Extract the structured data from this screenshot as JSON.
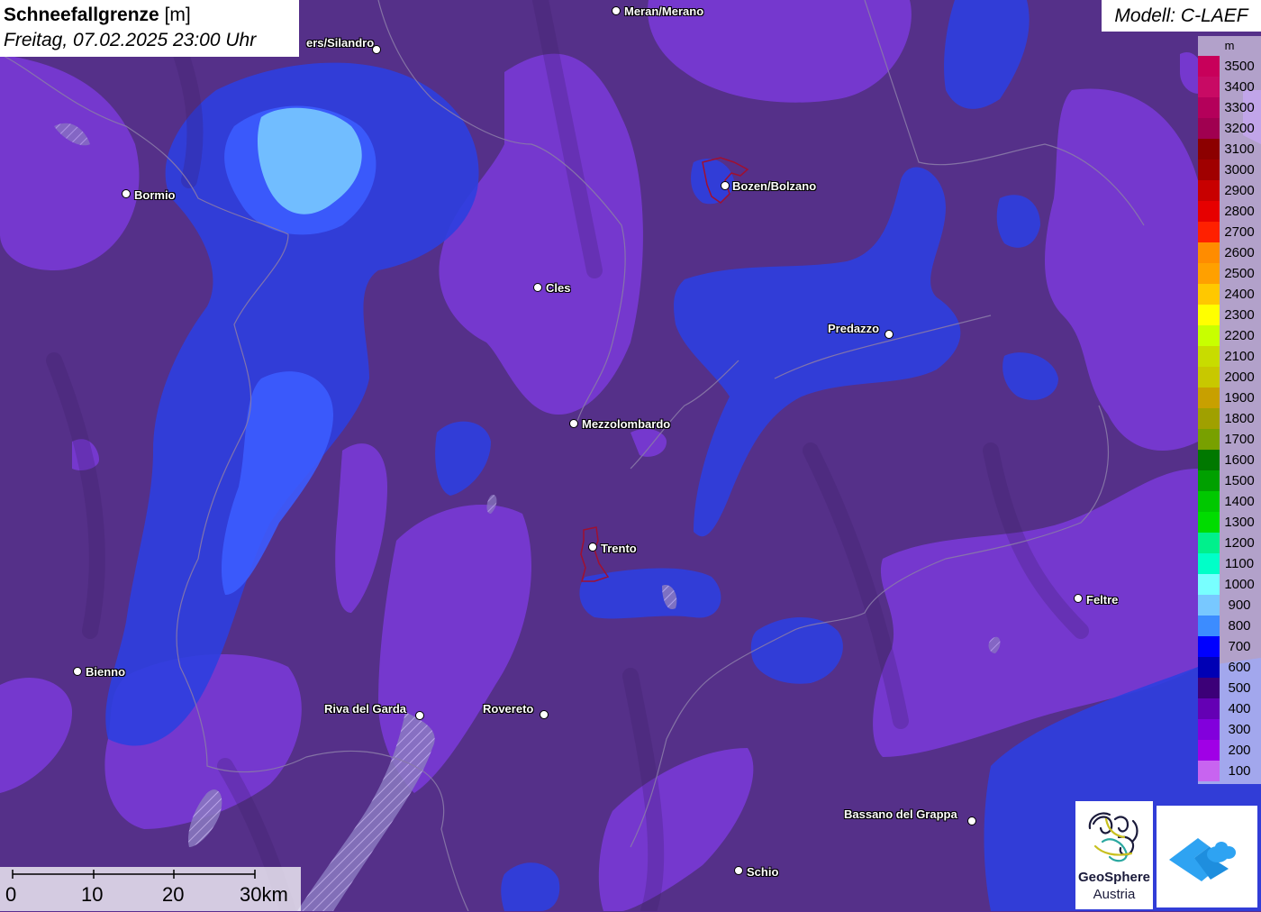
{
  "title": {
    "parameter": "Schneefallgrenze",
    "unit": "[m]",
    "datetime": "Freitag, 07.02.2025 23:00 Uhr"
  },
  "model_label": "Modell: C-LAEF",
  "legend": {
    "unit": "m",
    "entries": [
      {
        "label": "3500",
        "color": "#c8005a"
      },
      {
        "label": "3400",
        "color": "#c80a64"
      },
      {
        "label": "3300",
        "color": "#b4005a"
      },
      {
        "label": "3200",
        "color": "#a00050"
      },
      {
        "label": "3100",
        "color": "#8c0000"
      },
      {
        "label": "3000",
        "color": "#a00000"
      },
      {
        "label": "2900",
        "color": "#c80000"
      },
      {
        "label": "2800",
        "color": "#e60000"
      },
      {
        "label": "2700",
        "color": "#ff2000"
      },
      {
        "label": "2600",
        "color": "#ff8c00"
      },
      {
        "label": "2500",
        "color": "#ffa000"
      },
      {
        "label": "2400",
        "color": "#ffc800"
      },
      {
        "label": "2300",
        "color": "#ffff00"
      },
      {
        "label": "2200",
        "color": "#c8ff00"
      },
      {
        "label": "2100",
        "color": "#c8dc00"
      },
      {
        "label": "2000",
        "color": "#c8c800"
      },
      {
        "label": "1900",
        "color": "#c8a000"
      },
      {
        "label": "1800",
        "color": "#a0a000"
      },
      {
        "label": "1700",
        "color": "#78a000"
      },
      {
        "label": "1600",
        "color": "#007800"
      },
      {
        "label": "1500",
        "color": "#00a000"
      },
      {
        "label": "1400",
        "color": "#00c800"
      },
      {
        "label": "1300",
        "color": "#00dc00"
      },
      {
        "label": "1200",
        "color": "#00f08c"
      },
      {
        "label": "1100",
        "color": "#00ffc8"
      },
      {
        "label": "1000",
        "color": "#78ffff"
      },
      {
        "label": "900",
        "color": "#78c8ff"
      },
      {
        "label": "800",
        "color": "#3c8cff"
      },
      {
        "label": "700",
        "color": "#0000ff"
      },
      {
        "label": "600",
        "color": "#0000b4"
      },
      {
        "label": "500",
        "color": "#3c0078"
      },
      {
        "label": "400",
        "color": "#6400b4"
      },
      {
        "label": "300",
        "color": "#8200dc"
      },
      {
        "label": "200",
        "color": "#a000e6"
      },
      {
        "label": "100",
        "color": "#c864f0"
      }
    ]
  },
  "cities": [
    {
      "name": "Meran/Merano"
    },
    {
      "name": "ers/Silandro"
    },
    {
      "name": "Bormio"
    },
    {
      "name": "Bozen/Bolzano"
    },
    {
      "name": "Cles"
    },
    {
      "name": "Predazzo"
    },
    {
      "name": "Mezzolombardo"
    },
    {
      "name": "Trento"
    },
    {
      "name": "Feltre"
    },
    {
      "name": "Bienno"
    },
    {
      "name": "Riva del Garda"
    },
    {
      "name": "Rovereto"
    },
    {
      "name": "Bassano del Grappa"
    },
    {
      "name": "Schio"
    }
  ],
  "scale_bar": {
    "labels": [
      "0",
      "10",
      "20",
      "30km"
    ]
  },
  "logos": {
    "geosphere_line1": "GeoSphere",
    "geosphere_line2": "Austria",
    "geosphere_icon": "geosphere-logo-icon",
    "app_icon": "weather-app-icon"
  },
  "colors": {
    "background_purple": "#5a2d8f",
    "dark_purple": "#4a2a7a",
    "light_purple": "#8a3ee0",
    "blue": "#2a3de6",
    "light_blue": "#3a66ff",
    "cyan": "#78c8ff"
  }
}
